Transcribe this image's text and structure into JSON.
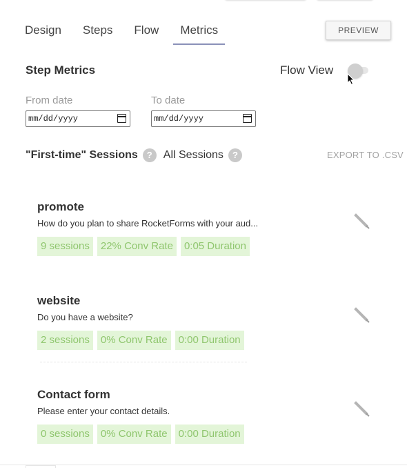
{
  "tabs": [
    {
      "label": "Design",
      "active": false
    },
    {
      "label": "Steps",
      "active": false
    },
    {
      "label": "Flow",
      "active": false
    },
    {
      "label": "Metrics",
      "active": true
    }
  ],
  "preview_label": "PREVIEW",
  "section_title": "Step Metrics",
  "flow_view": {
    "label": "Flow View",
    "enabled": false
  },
  "from_date": {
    "label": "From date",
    "value": "mm/dd/yyyy"
  },
  "to_date": {
    "label": "To date",
    "value": "mm/dd/yyyy"
  },
  "sessions": {
    "first_time_label": "\"First-time\" Sessions",
    "all_label": "All Sessions",
    "help_glyph": "?"
  },
  "export_label": "EXPORT TO .CSV",
  "steps": [
    {
      "name": "promote",
      "description": "How do you plan to share RocketForms with your aud...",
      "sessions": "9 sessions",
      "conv_rate": "22% Conv Rate",
      "duration": "0:05 Duration"
    },
    {
      "name": "website",
      "description": "Do you have a website?",
      "sessions": "2 sessions",
      "conv_rate": "0% Conv Rate",
      "duration": "0:00 Duration"
    },
    {
      "name": "Contact form",
      "description": "Please enter your contact details.",
      "sessions": "0 sessions",
      "conv_rate": "0% Conv Rate",
      "duration": "0:00 Duration"
    }
  ],
  "icons": {
    "edit": "pencil-icon",
    "help": "question-circle-icon",
    "calendar": "calendar-icon"
  },
  "colors": {
    "badge_bg": "#e3f5d8",
    "badge_text": "#8fc66e",
    "tab_underline": "#8a91b8"
  }
}
